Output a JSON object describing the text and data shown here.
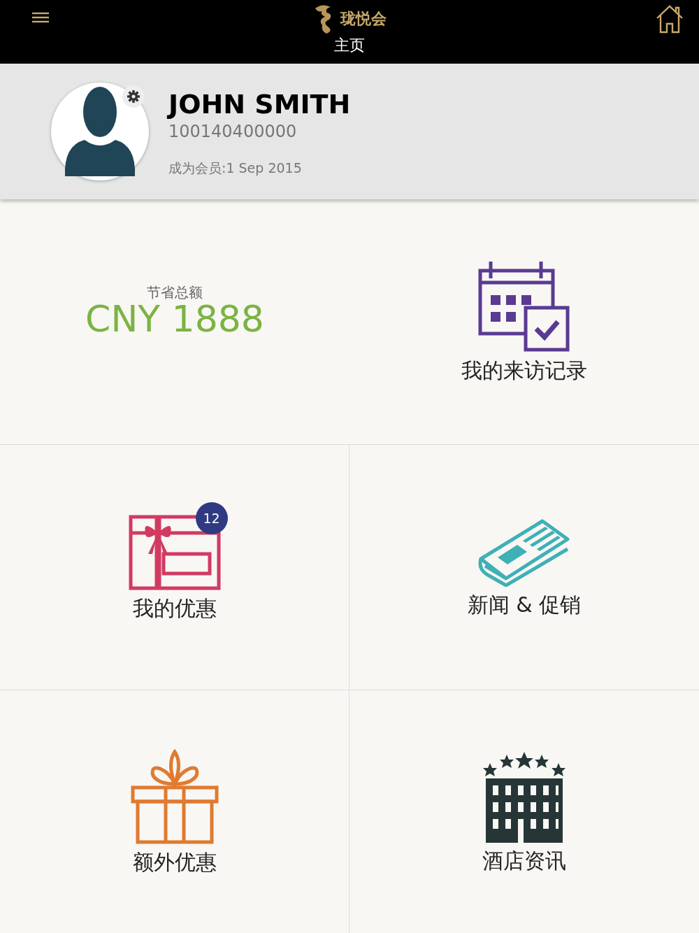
{
  "header": {
    "logo_text": "珑悦会",
    "title": "主页"
  },
  "profile": {
    "name": "JOHN SMITH",
    "member_number": "100140400000",
    "member_since": "成为会员:1 Sep 2015"
  },
  "tiles": [
    {
      "kind": "savings",
      "caption": "节省总额",
      "amount": "CNY 1888"
    },
    {
      "kind": "visits",
      "label": "我的来访记录"
    },
    {
      "kind": "offers",
      "label": "我的优惠",
      "badge": "12"
    },
    {
      "kind": "news",
      "label": "新闻 & 促销"
    },
    {
      "kind": "extra",
      "label": "额外优惠"
    },
    {
      "kind": "hotel",
      "label": "酒店资讯"
    }
  ]
}
